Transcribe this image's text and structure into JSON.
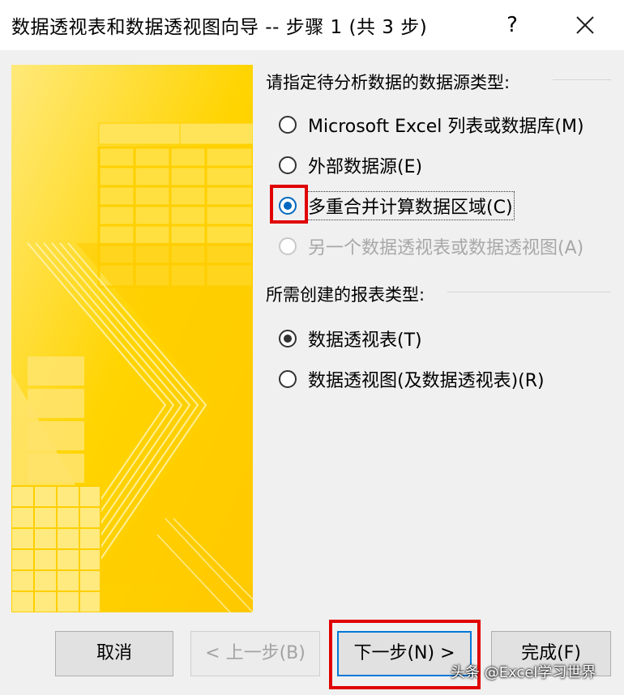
{
  "window": {
    "title": "数据透视表和数据透视图向导 -- 步骤 1 (共 3 步)",
    "help_label": "?",
    "close_icon": "close-icon"
  },
  "source_group": {
    "label": "请指定待分析数据的数据源类型:",
    "options": [
      {
        "label": "Microsoft Excel 列表或数据库(M)",
        "checked": false,
        "enabled": true
      },
      {
        "label": "外部数据源(E)",
        "checked": false,
        "enabled": true
      },
      {
        "label": "多重合并计算数据区域(C)",
        "checked": true,
        "enabled": true
      },
      {
        "label": "另一个数据透视表或数据透视图(A)",
        "checked": false,
        "enabled": false
      }
    ]
  },
  "report_group": {
    "label": "所需创建的报表类型:",
    "options": [
      {
        "label": "数据透视表(T)",
        "checked": true,
        "enabled": true
      },
      {
        "label": "数据透视图(及数据透视表)(R)",
        "checked": false,
        "enabled": true
      }
    ]
  },
  "buttons": {
    "cancel": "取消",
    "back": "< 上一步(B)",
    "next": "下一步(N) >",
    "finish": "完成(F)"
  },
  "watermark": "头条 @Excel学习世界",
  "colors": {
    "highlight": "#e00000",
    "accent": "#0067c0",
    "banner_yellow": "#ffd200"
  }
}
